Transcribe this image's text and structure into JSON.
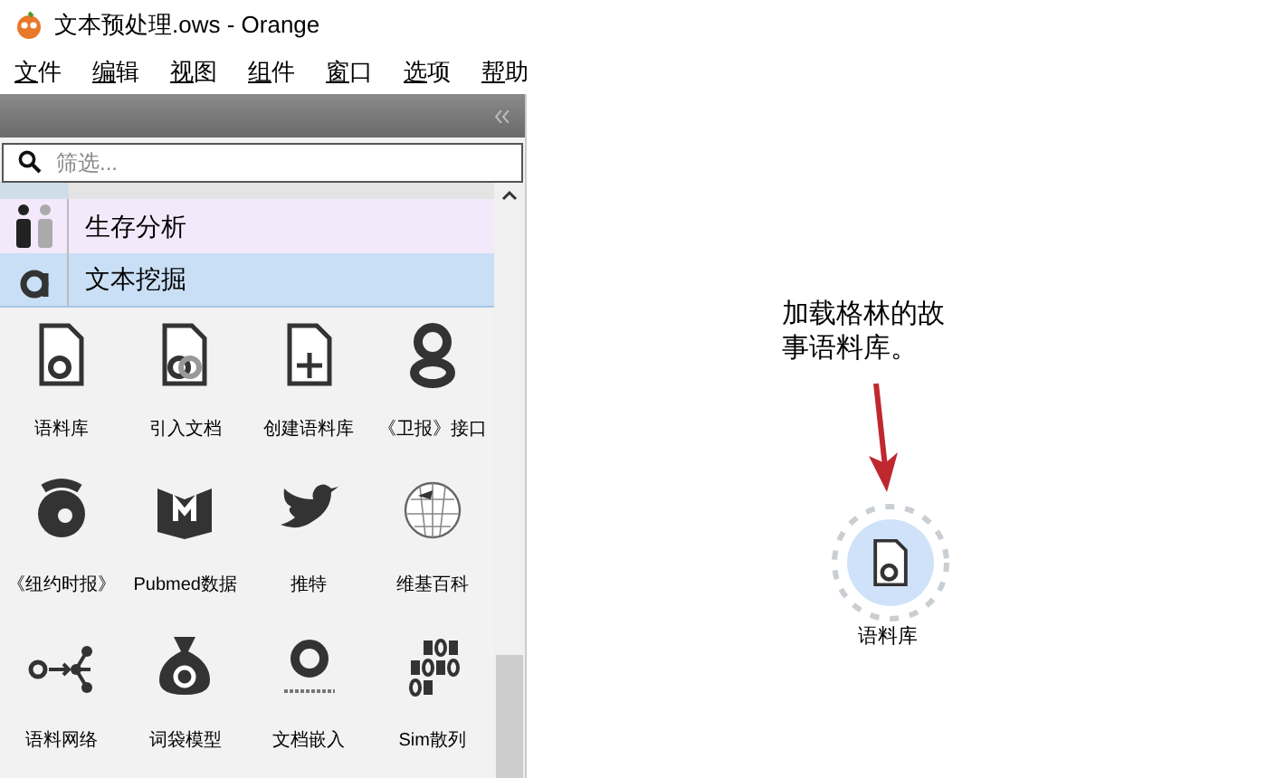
{
  "window": {
    "title": "文本预处理.ows - Orange"
  },
  "menu": [
    "文件",
    "编辑",
    "视图",
    "组件",
    "窗口",
    "选项",
    "帮助"
  ],
  "toolbox": {
    "search": {
      "placeholder": "筛选..."
    },
    "categories": [
      {
        "kind": "people",
        "label": "生存分析",
        "color": "#f3e9fb",
        "selected": false
      },
      {
        "kind": "letter",
        "label": "文本挖掘",
        "color": "#c9dff5",
        "selected": true
      }
    ],
    "widgets": [
      {
        "kind": "doc",
        "label": "语料库"
      },
      {
        "kind": "doc2",
        "label": "引入文档"
      },
      {
        "kind": "docplus",
        "label": "创建语料库"
      },
      {
        "kind": "g",
        "label": "《卫报》接口"
      },
      {
        "kind": "t",
        "label": "《纽约时报》"
      },
      {
        "kind": "book",
        "label": "Pubmed数据"
      },
      {
        "kind": "bird",
        "label": "推特"
      },
      {
        "kind": "globe",
        "label": "维基百科"
      },
      {
        "kind": "network",
        "label": "语料网络"
      },
      {
        "kind": "bag",
        "label": "词袋模型"
      },
      {
        "kind": "embed",
        "label": "文档嵌入"
      },
      {
        "kind": "binary",
        "label": "Sim散列"
      }
    ]
  },
  "canvas": {
    "annotation": "加载格林的故事语料库。",
    "node": {
      "label": "语料库"
    }
  }
}
